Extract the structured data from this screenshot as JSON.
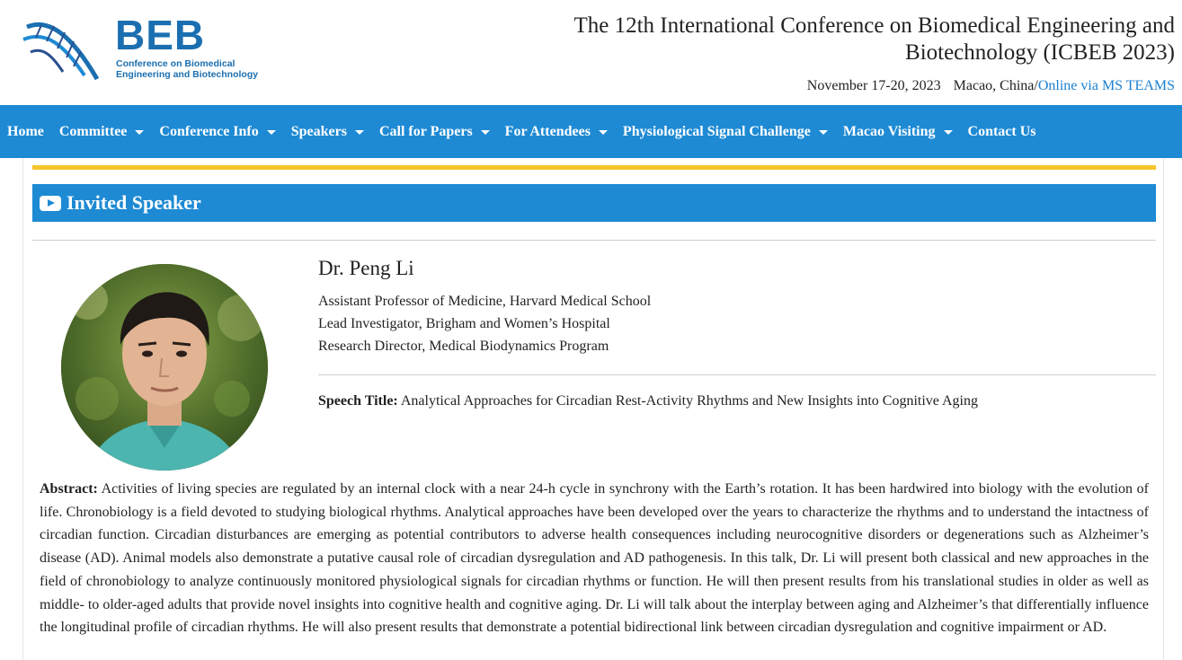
{
  "header": {
    "logo_text": "BEB",
    "logo_subtitle": "Conference on Biomedical Engineering and Biotechnology",
    "conference_title": "The 12th International Conference on Biomedical Engineering and Biotechnology (ICBEB 2023)",
    "date": "November 17-20, 2023",
    "location": "Macao, China/",
    "online_link": "Online via MS TEAMS"
  },
  "nav": {
    "items": [
      {
        "label": "Home",
        "dropdown": false
      },
      {
        "label": "Committee",
        "dropdown": true
      },
      {
        "label": "Conference Info",
        "dropdown": true
      },
      {
        "label": "Speakers",
        "dropdown": true
      },
      {
        "label": "Call for Papers",
        "dropdown": true
      },
      {
        "label": "For Attendees",
        "dropdown": true
      },
      {
        "label": "Physiological Signal Challenge",
        "dropdown": true
      },
      {
        "label": "Macao Visiting",
        "dropdown": true
      },
      {
        "label": "Contact Us",
        "dropdown": false
      }
    ]
  },
  "section": {
    "title": "Invited Speaker",
    "icon": "youtube-play-icon"
  },
  "speaker": {
    "name": "Dr. Peng Li",
    "affiliations": [
      "Assistant Professor of Medicine, Harvard Medical School",
      "Lead Investigator, Brigham and Women’s Hospital",
      "Research Director, Medical Biodynamics Program"
    ],
    "speech_label": "Speech Title:",
    "speech_title": "Analytical Approaches for Circadian Rest-Activity Rhythms and New Insights into Cognitive Aging",
    "abstract_label": "Abstract:",
    "abstract_text": "Activities of living species are regulated by an internal clock with a near 24-h cycle in synchrony with the Earth’s rotation. It has been hardwired into biology with the evolution of life. Chronobiology is a field devoted to studying biological rhythms. Analytical approaches have been developed over the years to characterize the rhythms and to understand the intactness of circadian function. Circadian disturbances are emerging as potential contributors to adverse health consequences including neurocognitive disorders or degenerations such as Alzheimer’s disease (AD). Animal models also demonstrate a putative causal role of circadian dysregulation and AD pathogenesis. In this talk, Dr. Li will present both classical and new approaches in the field of chronobiology to analyze continuously monitored physiological signals for circadian rhythms or function. He will then present results from his translational studies in older as well as middle- to older-aged adults that provide novel insights into cognitive health and cognitive aging. Dr. Li will talk about the interplay between aging and Alzheimer’s that differentially influence the longitudinal profile of circadian rhythms. He will also present results that demonstrate a potential bidirectional link between circadian dysregulation and cognitive impairment or AD."
  },
  "colors": {
    "brand_blue": "#1e8ad4",
    "accent_yellow": "#f6c52a",
    "link_blue": "#1a7fd0"
  }
}
